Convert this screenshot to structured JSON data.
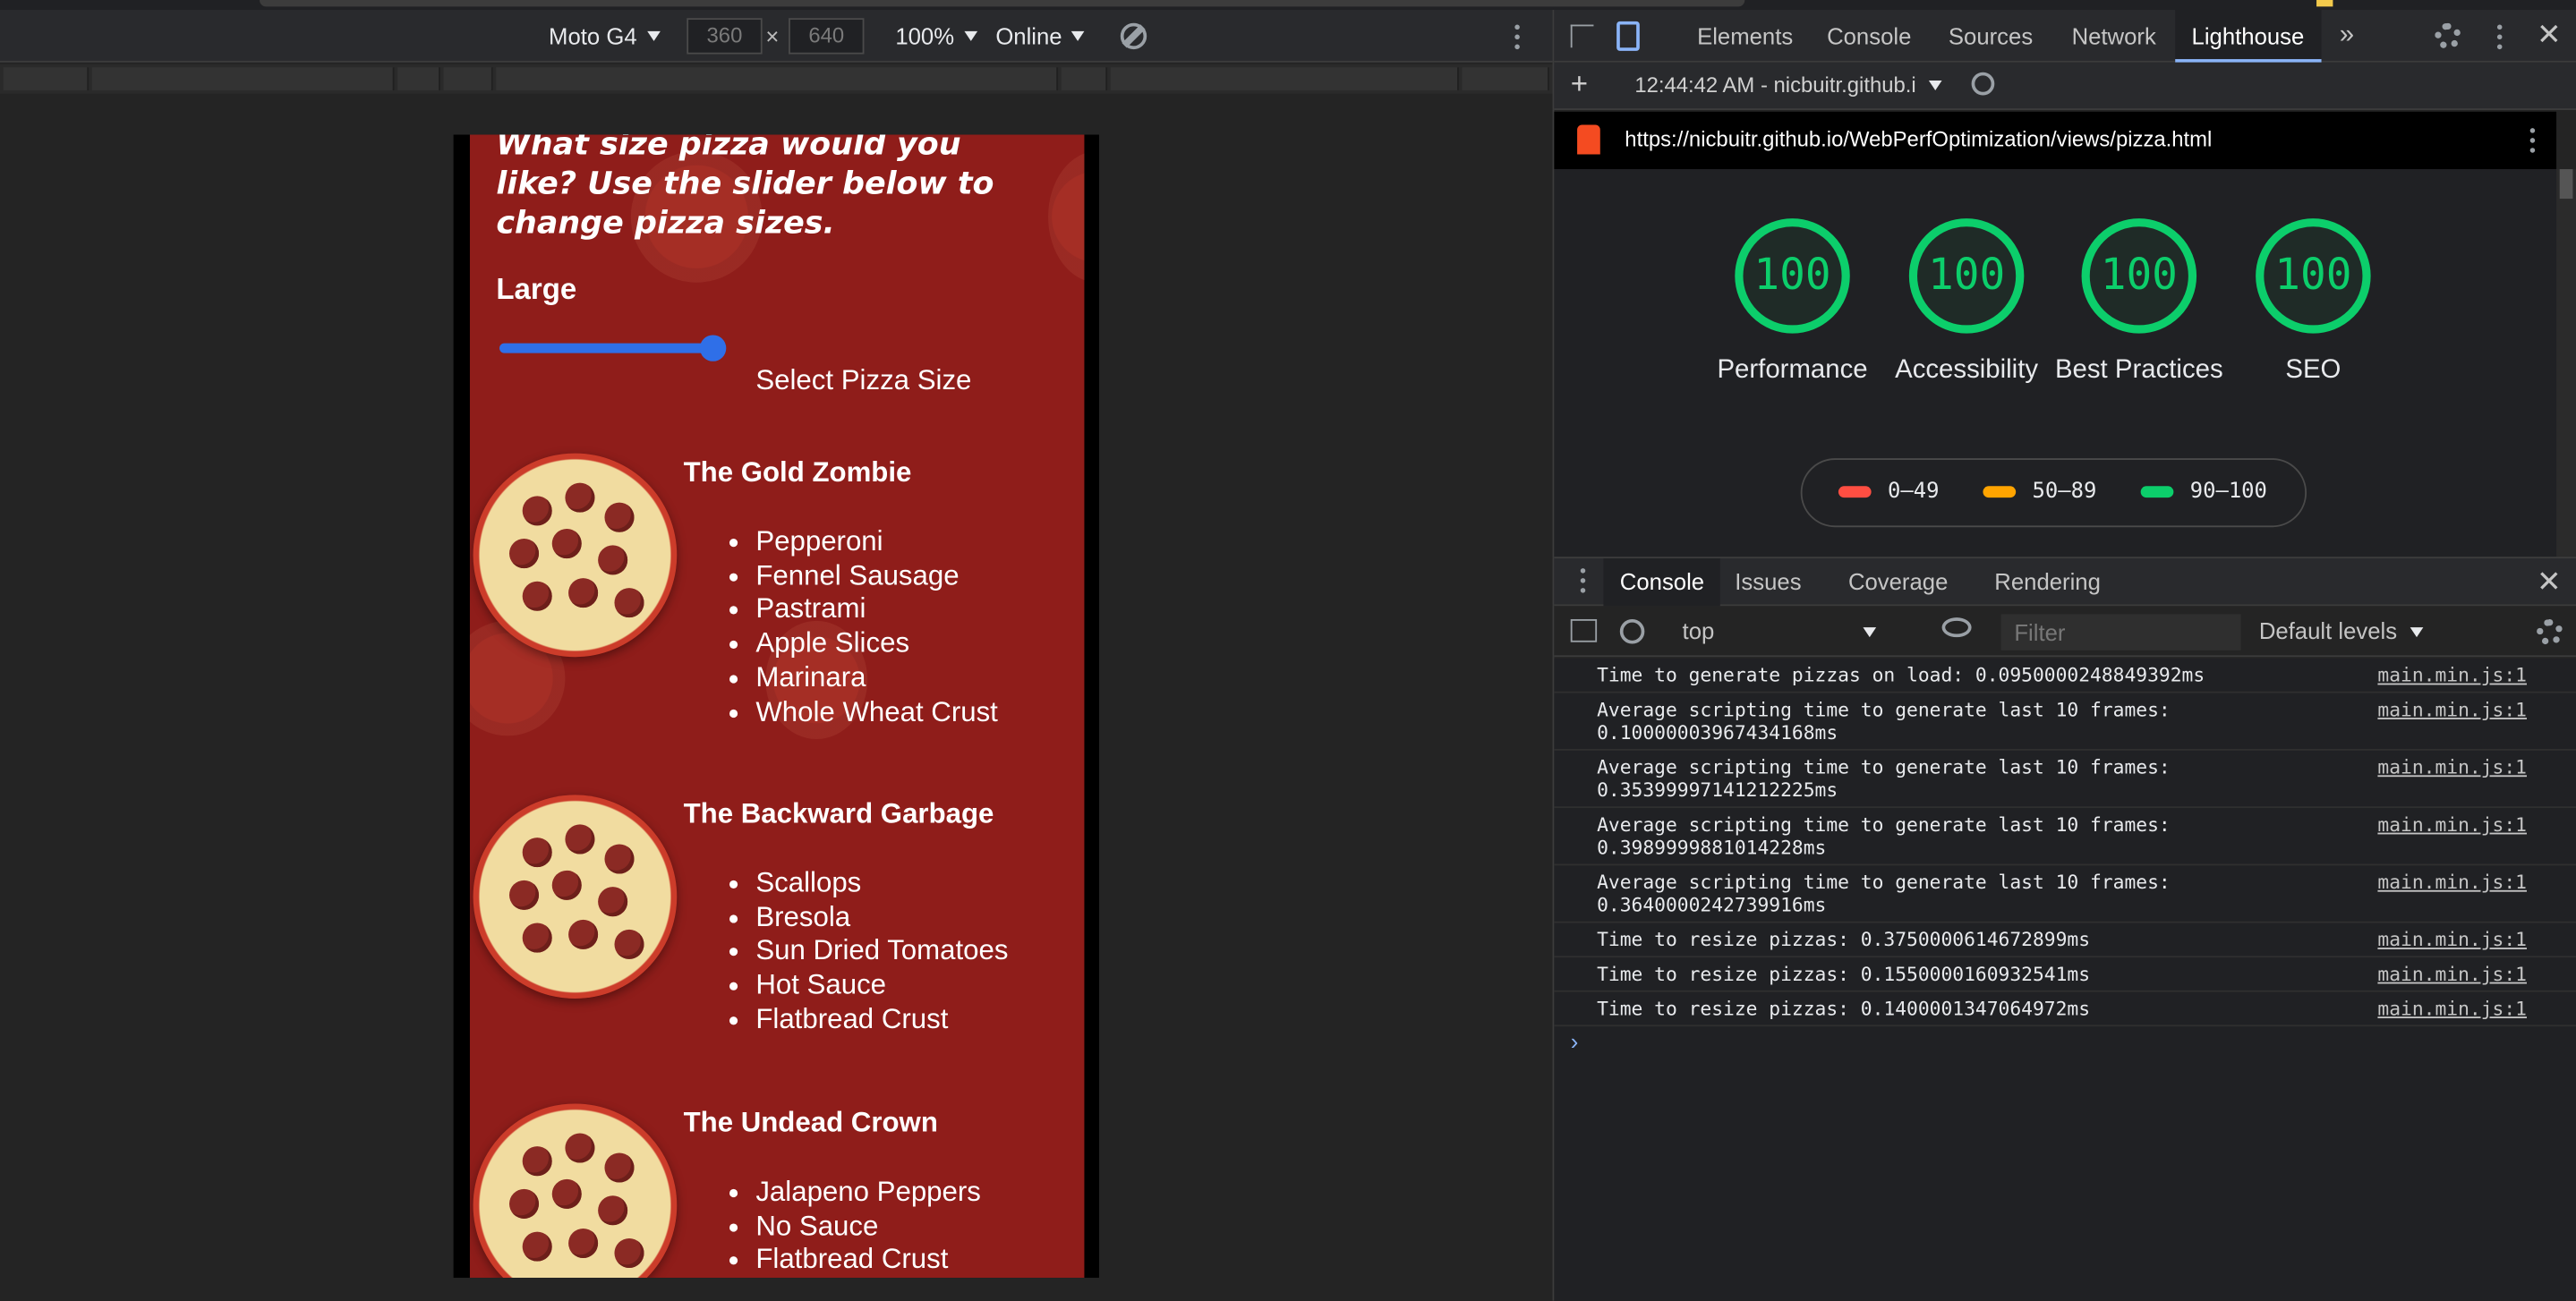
{
  "device_toolbar": {
    "device": "Moto G4",
    "width": "360",
    "height": "640",
    "times": "×",
    "zoom": "100%",
    "throttling": "Online"
  },
  "pizza_page": {
    "title": "What size pizza would you like? Use the slider below to change pizza sizes.",
    "size_label": "Large",
    "slider_caption": "Select Pizza Size",
    "slider_value": 1.0,
    "pizzas": [
      {
        "name": "The Gold Zombie",
        "ingredients": [
          "Pepperoni",
          "Fennel Sausage",
          "Pastrami",
          "Apple Slices",
          "Marinara",
          "Whole Wheat Crust"
        ]
      },
      {
        "name": "The Backward Garbage",
        "ingredients": [
          "Scallops",
          "Bresola",
          "Sun Dried Tomatoes",
          "Hot Sauce",
          "Flatbread Crust"
        ]
      },
      {
        "name": "The Undead Crown",
        "ingredients": [
          "Jalapeno Peppers",
          "No Sauce",
          "Flatbread Crust"
        ]
      }
    ]
  },
  "devtools": {
    "tabs": [
      "Elements",
      "Console",
      "Sources",
      "Network",
      "Lighthouse"
    ],
    "active_tab": "Lighthouse",
    "more_tabs": "»",
    "lighthouse_report": "12:44:42 AM - nicbuitr.github.i",
    "audited_url": "https://nicbuitr.github.io/WebPerfOptimization/views/pizza.html",
    "scores": [
      {
        "label": "Performance",
        "value": "100"
      },
      {
        "label": "Accessibility",
        "value": "100"
      },
      {
        "label": "Best Practices",
        "value": "100"
      },
      {
        "label": "SEO",
        "value": "100"
      }
    ],
    "legend": [
      {
        "range": "0–49",
        "color": "#ff4e42"
      },
      {
        "range": "50–89",
        "color": "#ffa400"
      },
      {
        "range": "90–100",
        "color": "#0cce6b"
      }
    ]
  },
  "drawer": {
    "tabs": [
      "Console",
      "Issues",
      "Coverage",
      "Rendering"
    ],
    "active_tab": "Console",
    "context": "top",
    "filter_placeholder": "Filter",
    "levels": "Default levels",
    "logs": [
      {
        "msg": "Time to generate pizzas on load: 0.0950000248849392ms",
        "src": "main.min.js:1"
      },
      {
        "msg": "Average scripting time to generate last 10 frames:\n0.10000003967434168ms",
        "src": "main.min.js:1"
      },
      {
        "msg": "Average scripting time to generate last 10 frames:\n0.35399997141212225ms",
        "src": "main.min.js:1"
      },
      {
        "msg": "Average scripting time to generate last 10 frames:\n0.3989999881014228ms",
        "src": "main.min.js:1"
      },
      {
        "msg": "Average scripting time to generate last 10 frames:\n0.3640000242739916ms",
        "src": "main.min.js:1"
      },
      {
        "msg": "Time to resize pizzas: 0.3750000614672899ms",
        "src": "main.min.js:1"
      },
      {
        "msg": "Time to resize pizzas: 0.1550000160932541ms",
        "src": "main.min.js:1"
      },
      {
        "msg": "Time to resize pizzas: 0.1400001347064972ms",
        "src": "main.min.js:1"
      }
    ],
    "prompt": "›"
  },
  "colors": {
    "accent": "#8ab4f8",
    "score_green": "#0cce6b",
    "pizza_bg": "#8f1d1a",
    "slider": "#2f6fe8"
  }
}
